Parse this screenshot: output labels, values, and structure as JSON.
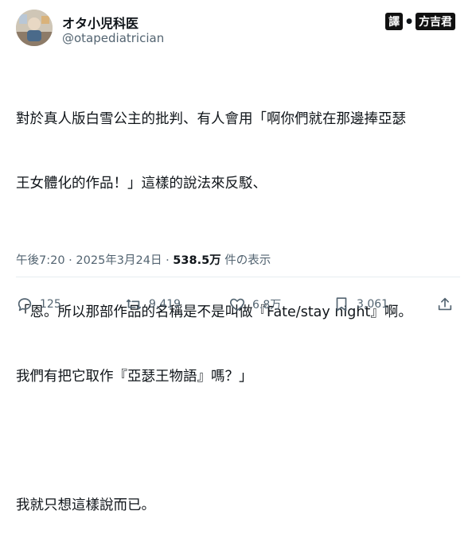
{
  "author": {
    "display_name": "オタ小児科医",
    "handle": "@otapediatrician"
  },
  "watermark": {
    "badge": "譯",
    "dot": "●",
    "name": "方吉君"
  },
  "post": {
    "lines": [
      "對於真人版白雪公主的批判、有人會用「啊你們就在那邊捧亞瑟",
      "王女體化的作品！」這樣的說法來反駁、",
      "",
      "「恩。所以那部作品的名稱是不是叫做『Fate/stay night』啊。",
      "我們有把它取作『亞瑟王物語』嗎？」",
      "",
      "我就只想這樣說而已。"
    ]
  },
  "meta": {
    "time": "午後7:20",
    "sep1": " · ",
    "date": "2025年3月24日",
    "sep2": " · ",
    "views": "538.5万",
    "views_label": " 件の表示"
  },
  "actions": {
    "replies": "125",
    "reposts": "9,419",
    "likes": "6.8万",
    "bookmarks": "3,061"
  },
  "colors": {
    "text": "#0f1419",
    "secondary": "#536471"
  }
}
